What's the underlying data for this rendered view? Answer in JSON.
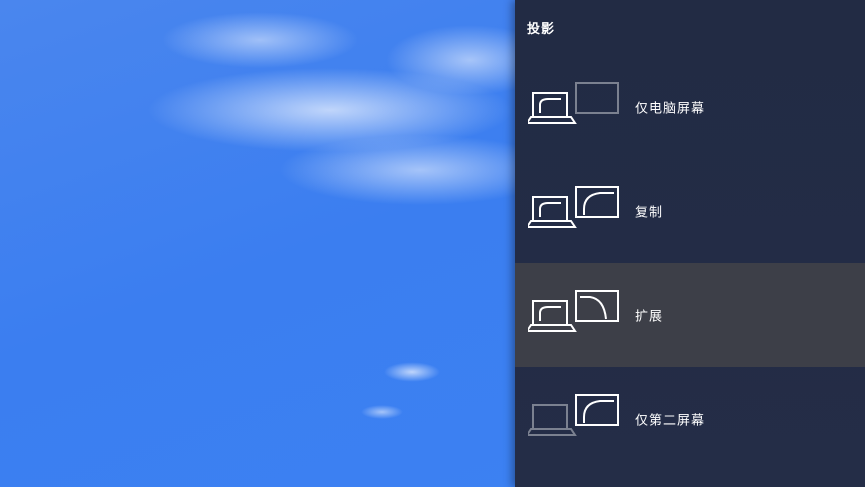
{
  "panel": {
    "title": "投影",
    "options": [
      {
        "label": "仅电脑屏幕",
        "icon": "pc-screen-only-icon"
      },
      {
        "label": "复制",
        "icon": "duplicate-icon"
      },
      {
        "label": "扩展",
        "icon": "extend-icon",
        "selected": true
      },
      {
        "label": "仅第二屏幕",
        "icon": "second-screen-only-icon"
      }
    ]
  },
  "colors": {
    "panel_background": "#232c46",
    "selected_background": "#3d3f48",
    "icon_active": "#ffffff",
    "icon_inactive": "#7b8190"
  }
}
